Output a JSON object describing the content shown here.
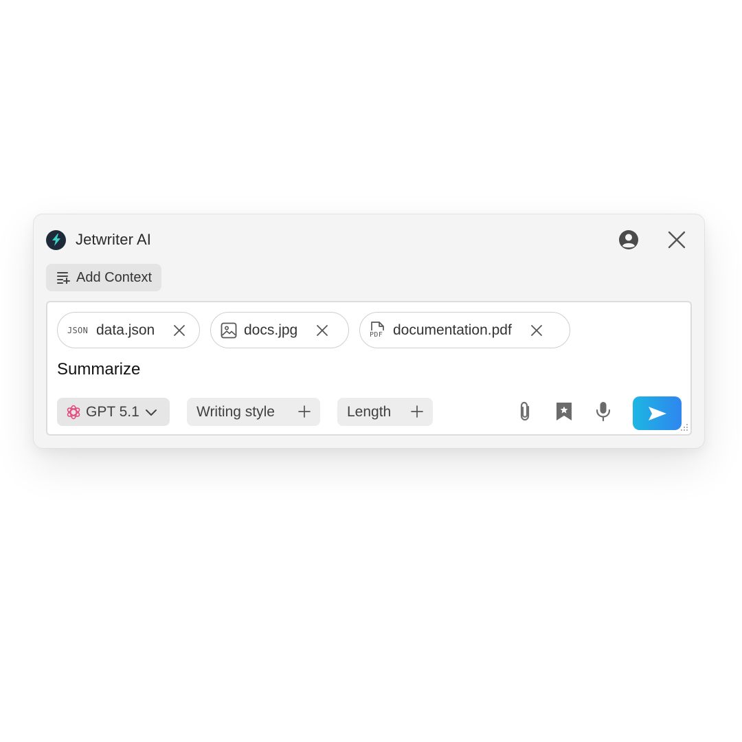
{
  "app": {
    "title": "Jetwriter AI",
    "logo_icon": "bolt-icon",
    "logo_color": "#1e2a3a",
    "logo_accent": "#3ed0c5"
  },
  "header": {
    "account_icon": "account-circle-icon",
    "close_icon": "close-icon"
  },
  "context": {
    "add_label": "Add Context",
    "icon": "list-add-icon"
  },
  "attachments": [
    {
      "type_tag": "JSON",
      "name": "data.json",
      "icon": "json-icon"
    },
    {
      "name": "docs.jpg",
      "icon": "image-icon"
    },
    {
      "type_tag": "PDF",
      "name": "documentation.pdf",
      "icon": "pdf-file-icon"
    }
  ],
  "composer": {
    "text": "Summarize"
  },
  "toolbar": {
    "model": {
      "label": "GPT 5.1",
      "icon": "openai-icon",
      "icon_color": "#e2467a"
    },
    "writing_style_label": "Writing style",
    "length_label": "Length",
    "attach_icon": "paperclip-icon",
    "bookmark_icon": "bookmark-star-icon",
    "mic_icon": "microphone-icon",
    "send_icon": "send-icon",
    "send_gradient": [
      "#1db6e3",
      "#2f86ee"
    ]
  }
}
